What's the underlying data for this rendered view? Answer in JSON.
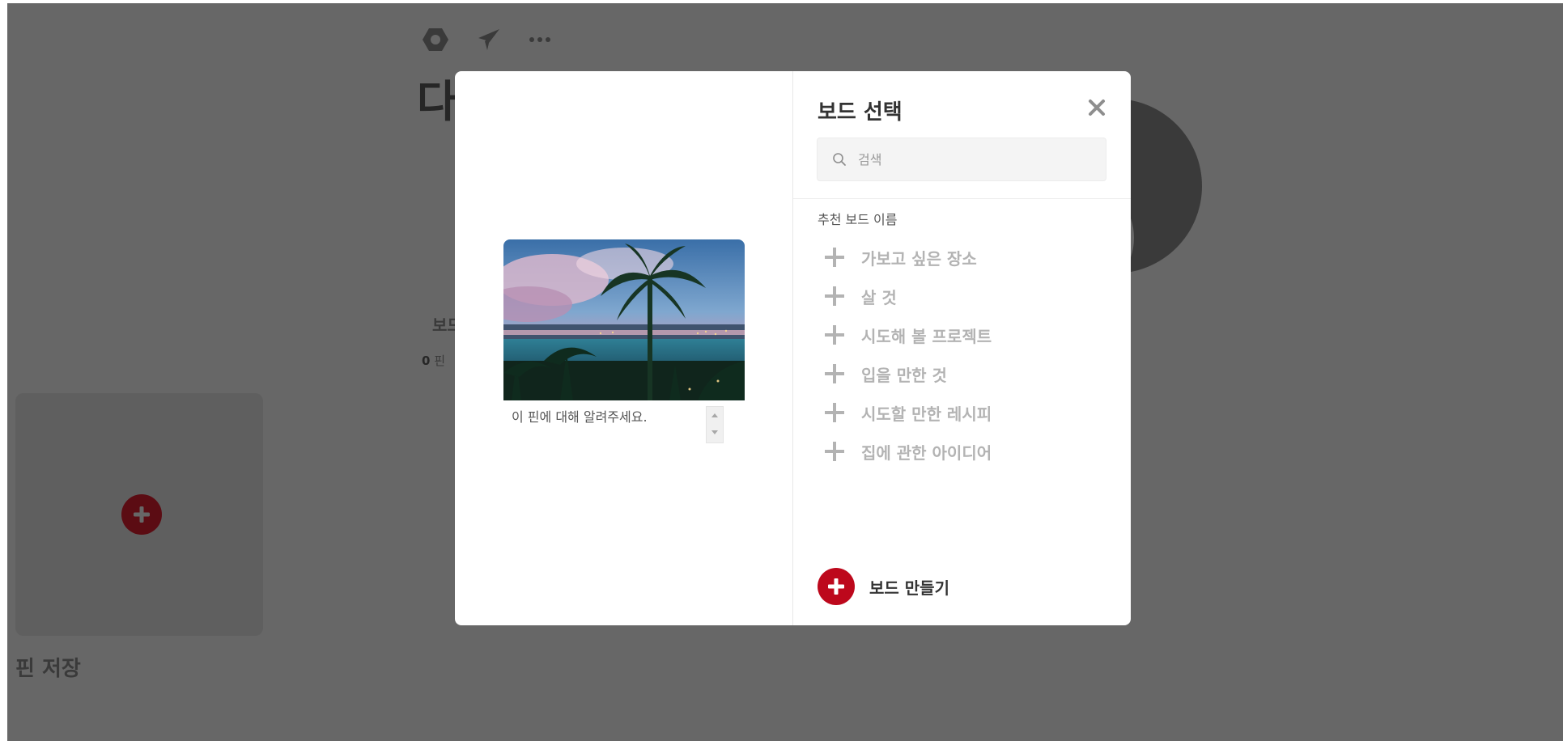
{
  "background": {
    "title": "다",
    "board_label": "보드",
    "pin_count_number": "0",
    "pin_count_unit": "핀",
    "save_pin_label": "핀 저장",
    "icons": [
      "settings-icon",
      "send-icon",
      "more-icon"
    ]
  },
  "modal": {
    "title": "보드 선택",
    "search": {
      "placeholder": "검색",
      "value": ""
    },
    "suggested_label": "추천 보드 이름",
    "boards": [
      {
        "label": "가보고 싶은 장소"
      },
      {
        "label": "살 것"
      },
      {
        "label": "시도해 볼 프로젝트"
      },
      {
        "label": "입을 만한 것"
      },
      {
        "label": "시도할 만한 레시피"
      },
      {
        "label": "집에 관한 아이디어"
      }
    ],
    "pin_description_placeholder": "이 핀에 대해 알려주세요.",
    "create_board_label": "보드 만들기"
  },
  "colors": {
    "overlay": "#676767",
    "accent": "#bd081c",
    "board_item_text": "#b3b3b3"
  }
}
